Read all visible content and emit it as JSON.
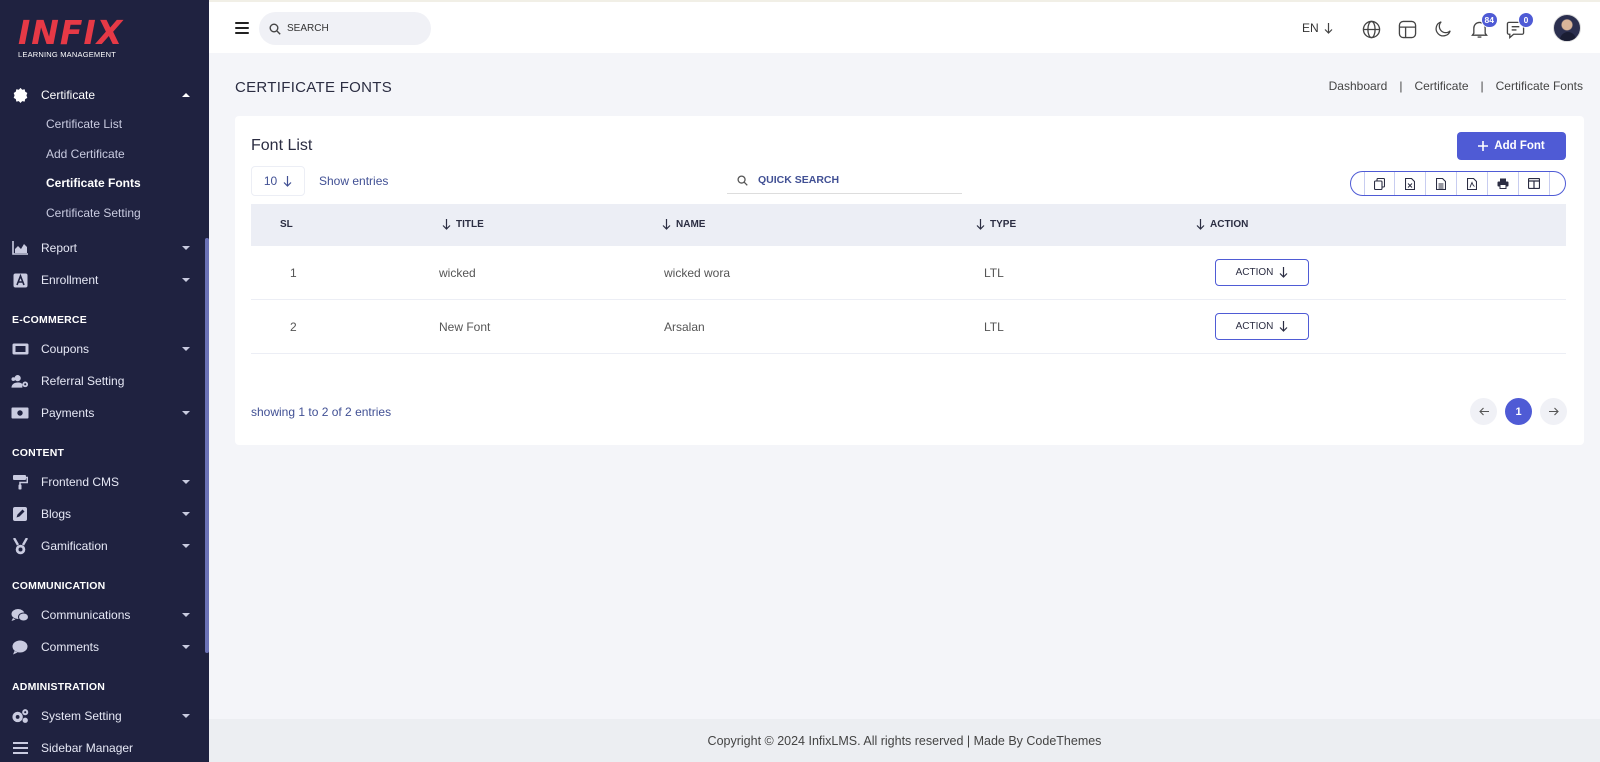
{
  "brand": {
    "logo": "INFIX",
    "tagline": "LEARNING MANAGEMENT"
  },
  "sidebar": {
    "certificate": "Certificate",
    "sub_items": [
      "Certificate List",
      "Add Certificate",
      "Certificate Fonts",
      "Certificate Setting"
    ],
    "report": "Report",
    "enrollment": "Enrollment",
    "section_ecommerce": "E-COMMERCE",
    "coupons": "Coupons",
    "referral": "Referral Setting",
    "payments": "Payments",
    "section_content": "CONTENT",
    "frontend_cms": "Frontend CMS",
    "blogs": "Blogs",
    "gamification": "Gamification",
    "section_communication": "COMMUNICATION",
    "communications": "Communications",
    "comments": "Comments",
    "section_administration": "ADMINISTRATION",
    "system_setting": "System Setting",
    "sidebar_manager": "Sidebar Manager"
  },
  "header": {
    "search_placeholder": "SEARCH",
    "language": "EN",
    "notification_count": "84",
    "message_count": "0"
  },
  "page": {
    "title": "CERTIFICATE FONTS",
    "breadcrumb": [
      "Dashboard",
      "Certificate",
      "Certificate Fonts"
    ]
  },
  "card": {
    "title": "Font List",
    "add_button": "Add Font",
    "entries_value": "10",
    "entries_label": "Show entries",
    "quick_search_placeholder": "QUICK SEARCH",
    "columns": [
      "SL",
      "TITLE",
      "NAME",
      "TYPE",
      "ACTION"
    ],
    "rows": [
      {
        "sl": "1",
        "title": "wicked",
        "name": "wicked wora",
        "type": "LTL",
        "action": "ACTION"
      },
      {
        "sl": "2",
        "title": "New Font",
        "name": "Arsalan",
        "type": "LTL",
        "action": "ACTION"
      }
    ],
    "showing": "showing 1 to 2 of 2 entries",
    "current_page": "1"
  },
  "footer": "Copyright © 2024 InfixLMS. All rights reserved | Made By CodeThemes",
  "colors": {
    "accent": "#4f5bd5",
    "sidebar_bg": "#1f2240",
    "logo_red": "#e63946"
  }
}
